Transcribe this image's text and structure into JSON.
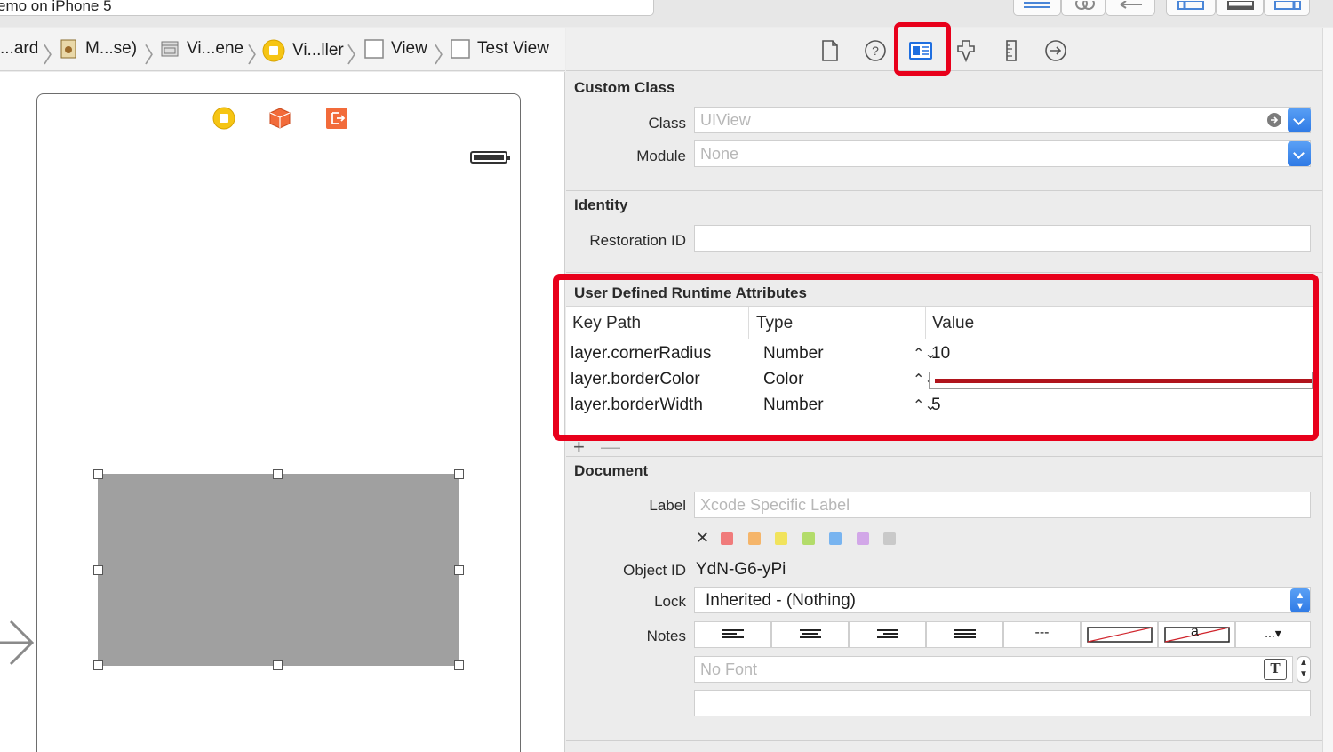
{
  "window": {
    "title_fragment": "emo on iPhone 5"
  },
  "breadcrumb": [
    {
      "label": "...ard",
      "icon": "storyboard-icon"
    },
    {
      "label": "M...se)",
      "icon": "storyboard-file-icon"
    },
    {
      "label": "Vi...ene",
      "icon": "scene-icon"
    },
    {
      "label": "Vi...ller",
      "icon": "view-controller-icon"
    },
    {
      "label": "View",
      "icon": "view-icon"
    },
    {
      "label": "Test View",
      "icon": "view-icon"
    }
  ],
  "inspector_tabs": [
    {
      "name": "file-inspector",
      "icon": "file-icon"
    },
    {
      "name": "quick-help",
      "icon": "help-icon"
    },
    {
      "name": "identity-inspector",
      "icon": "identity-icon",
      "selected": true
    },
    {
      "name": "attributes-inspector",
      "icon": "attributes-icon"
    },
    {
      "name": "size-inspector",
      "icon": "ruler-icon"
    },
    {
      "name": "connections-inspector",
      "icon": "arrow-circle-icon"
    }
  ],
  "custom_class": {
    "title": "Custom Class",
    "class_label": "Class",
    "class_placeholder": "UIView",
    "module_label": "Module",
    "module_placeholder": "None"
  },
  "identity": {
    "title": "Identity",
    "restoration_label": "Restoration ID",
    "restoration_value": ""
  },
  "runtime_attributes": {
    "title": "User Defined Runtime Attributes",
    "headers": [
      "Key Path",
      "Type",
      "Value"
    ],
    "rows": [
      {
        "key_path": "layer.cornerRadius",
        "type": "Number",
        "value": "10"
      },
      {
        "key_path": "layer.borderColor",
        "type": "Color",
        "value": "",
        "color": "#b0141c"
      },
      {
        "key_path": "layer.borderWidth",
        "type": "Number",
        "value": "5"
      }
    ],
    "add_symbol": "+",
    "remove_symbol": "—"
  },
  "document": {
    "title": "Document",
    "label_label": "Label",
    "label_placeholder": "Xcode Specific Label",
    "clear_symbol": "✕",
    "label_colors": [
      "#f07b7b",
      "#f5b56a",
      "#f1e35c",
      "#b3dc6a",
      "#78b4f0",
      "#d2a7e8",
      "#c9c9c9"
    ],
    "object_id_label": "Object ID",
    "object_id": "YdN-G6-yPi",
    "lock_label": "Lock",
    "lock_value": "Inherited - (Nothing)",
    "notes_label": "Notes",
    "notes_buttons": [
      "align-left",
      "align-center",
      "align-right",
      "align-justify",
      "---",
      "strike-box",
      "a",
      "...▾"
    ],
    "font_placeholder": "No Font"
  },
  "colors": {
    "highlight": "#e8001b",
    "accent": "#2f7ae5",
    "view_fill": "#a0a0a0"
  }
}
